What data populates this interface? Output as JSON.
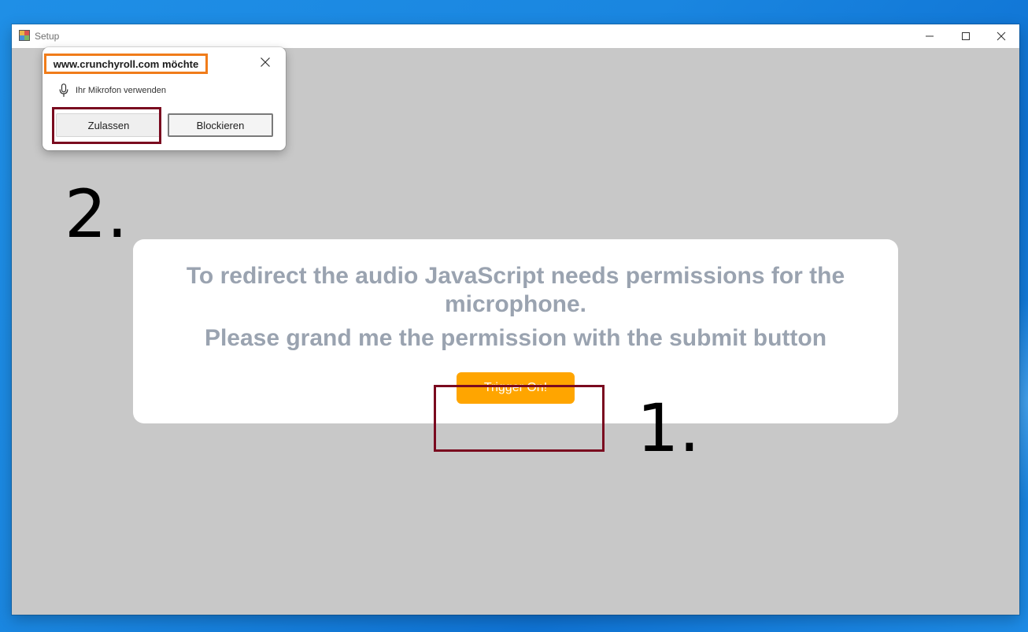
{
  "window": {
    "title": "Setup"
  },
  "card": {
    "line1": "To redirect the audio JavaScript needs permissions for the",
    "line2": "microphone.",
    "line3": "Please grand me the permission with the submit button",
    "trigger_label": "Trigger On!"
  },
  "annotations": {
    "step1": "1.",
    "step2": "2."
  },
  "popup": {
    "title": "www.crunchyroll.com möchte",
    "permission": "Ihr Mikrofon verwenden",
    "allow_label": "Zulassen",
    "block_label": "Blockieren",
    "icons": {
      "close": "close-icon",
      "mic": "microphone-icon"
    }
  },
  "colors": {
    "client_bg": "#c8c8c8",
    "card_text": "#9aa3b0",
    "trigger_bg": "#ffa500",
    "highlight_red": "#7a0a1f",
    "highlight_orange": "#f07c1a",
    "desktop_blue": "#1a86e0"
  }
}
